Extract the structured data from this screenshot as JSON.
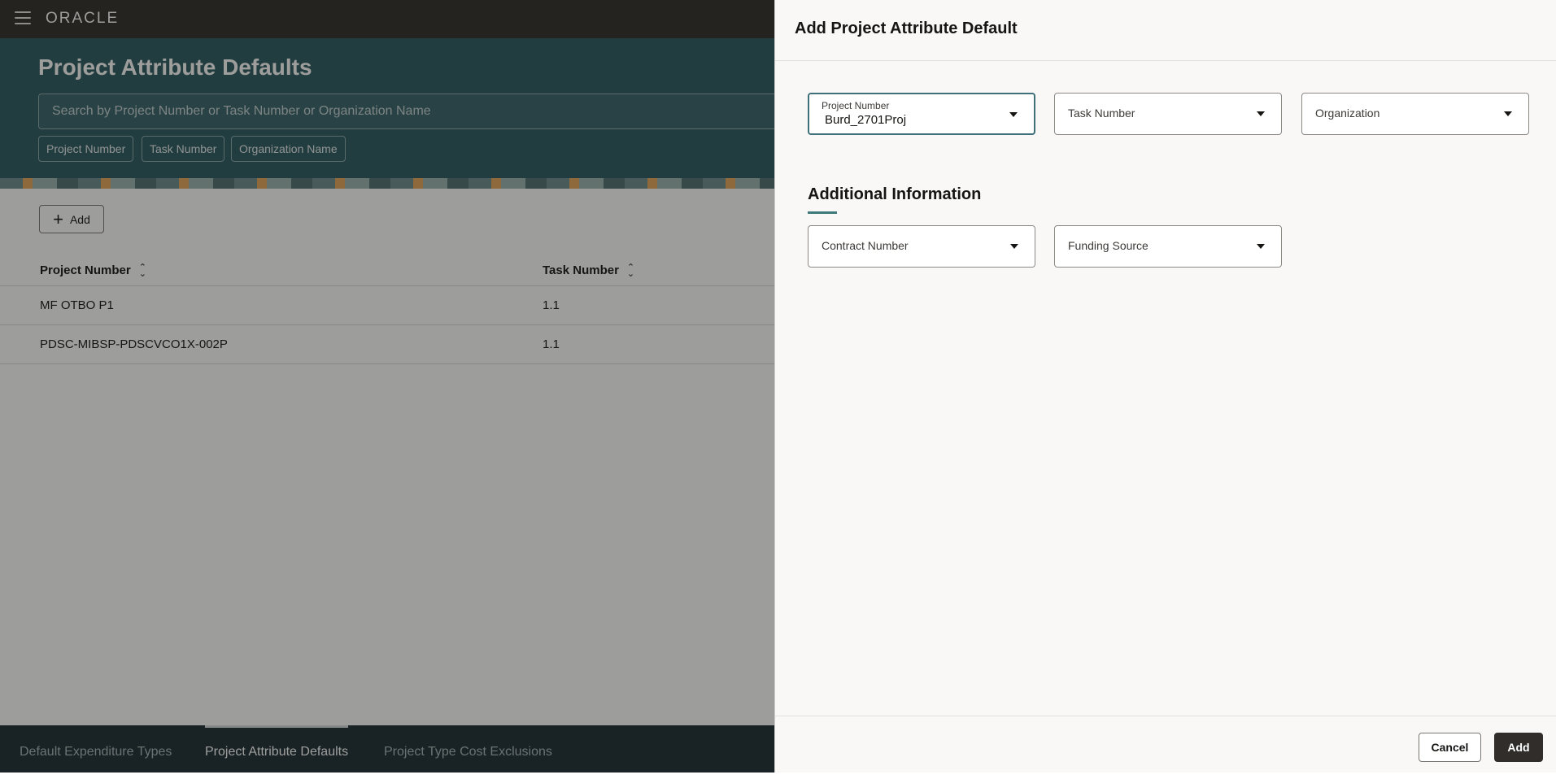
{
  "topbar": {
    "menu_icon": "hamburger-menu-icon",
    "logo": "ORACLE"
  },
  "header": {
    "title": "Project Attribute Defaults",
    "search_placeholder": "Search by Project Number or Task Number or Organization Name",
    "chips": [
      "Project Number",
      "Task Number",
      "Organization Name"
    ]
  },
  "toolbar": {
    "add_label": "Add",
    "add_icon": "plus-icon"
  },
  "table": {
    "columns": [
      "Project Number",
      "Task Number"
    ],
    "rows": [
      {
        "project_number": "MF OTBO P1",
        "task_number": "1.1"
      },
      {
        "project_number": "PDSC-MIBSP-PDSCVCO1X-002P",
        "task_number": "1.1"
      }
    ]
  },
  "bottom_tabs": [
    {
      "label": "Default Expenditure Types",
      "active": false
    },
    {
      "label": "Project Attribute Defaults",
      "active": true
    },
    {
      "label": "Project Type Cost Exclusions",
      "active": false
    }
  ],
  "drawer": {
    "title": "Add Project Attribute Default",
    "fields": {
      "project_number": {
        "label": "Project Number",
        "value": "Burd_2701Proj"
      },
      "task_number": {
        "label": "Task Number"
      },
      "organization": {
        "label": "Organization"
      }
    },
    "section_title": "Additional Information",
    "additional_fields": {
      "contract_number": {
        "label": "Contract Number"
      },
      "funding_source": {
        "label": "Funding Source"
      }
    },
    "cancel_label": "Cancel",
    "add_label": "Add"
  },
  "colors": {
    "topbar": "#312d2a",
    "hero": "#2c5a61",
    "accent": "#3f7a7a",
    "primary_button": "#312d2a"
  }
}
